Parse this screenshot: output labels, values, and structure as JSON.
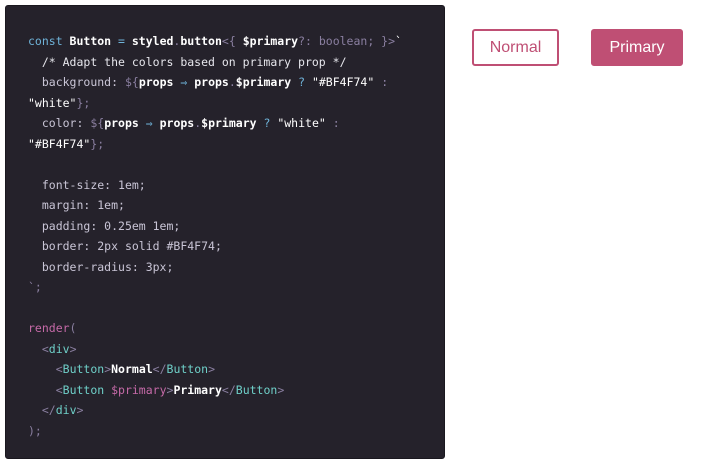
{
  "colors": {
    "accent": "#BF4F74",
    "editor_bg": "#25222b",
    "white": "#ffffff"
  },
  "code": {
    "l1": {
      "a": "const ",
      "b": "Button",
      "c": " = ",
      "d": "styled",
      "e": ".",
      "f": "button",
      "g": "<{ ",
      "h": "$primary",
      "i": "?: boolean; }>",
      "j": "`"
    },
    "l2": "/* Adapt the colors based on primary prop */",
    "l3": {
      "a": "background: ",
      "b": "${",
      "c": "props",
      "d": " ⇒ ",
      "e": "props",
      "f": ".",
      "g": "$primary",
      "h": " ? ",
      "i": "\"#BF4F74\"",
      "j": " :"
    },
    "l4": {
      "a": "\"white\"",
      "b": "};"
    },
    "l5": {
      "a": "color: ",
      "b": "${",
      "c": "props",
      "d": " ⇒ ",
      "e": "props",
      "f": ".",
      "g": "$primary",
      "h": " ? ",
      "i": "\"white\"",
      "j": " :"
    },
    "l6": {
      "a": "\"#BF4F74\"",
      "b": "};"
    },
    "l8": "font-size: 1em;",
    "l9": "margin: 1em;",
    "l10": "padding: 0.25em 1em;",
    "l11": "border: 2px solid #BF4F74;",
    "l12": "border-radius: 3px;",
    "l13": "`;",
    "l15": {
      "a": "render",
      "b": "("
    },
    "l16": {
      "a": "<",
      "b": "div",
      "c": ">"
    },
    "l17": {
      "a": "<",
      "b": "Button",
      "c": ">",
      "d": "Normal",
      "e": "</",
      "f": "Button",
      "g": ">"
    },
    "l18": {
      "a": "<",
      "b": "Button",
      "c": " $primary",
      "d": ">",
      "e": "Primary",
      "f": "</",
      "g": "Button",
      "h": ">"
    },
    "l19": {
      "a": "</",
      "b": "div",
      "c": ">"
    },
    "l20": ");"
  },
  "preview": {
    "normal_label": "Normal",
    "primary_label": "Primary"
  }
}
